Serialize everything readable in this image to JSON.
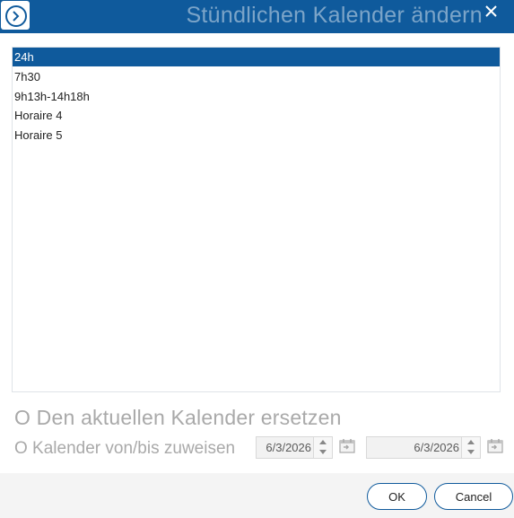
{
  "window": {
    "title": "Stündlichen Kalender ändern",
    "app_icon": "chevron-right-circle-icon",
    "close_icon": "close-icon"
  },
  "calendar_list": {
    "items": [
      "24h",
      "7h30",
      "9h13h-14h18h",
      "Horaire 4",
      "Horaire 5"
    ],
    "selected_index": 0
  },
  "options": {
    "replace_label": "O Den aktuellen Kalender ersetzen",
    "assign_label": "O Kalender von/bis zuweisen"
  },
  "date_from": {
    "value": "6/3/2026"
  },
  "date_to": {
    "value": "6/3/2026"
  },
  "buttons": {
    "ok": "OK",
    "cancel": "Cancel"
  },
  "colors": {
    "accent": "#0f5a9c",
    "disabled_text": "#a9a9a9",
    "footer": "#f4f4f4"
  }
}
